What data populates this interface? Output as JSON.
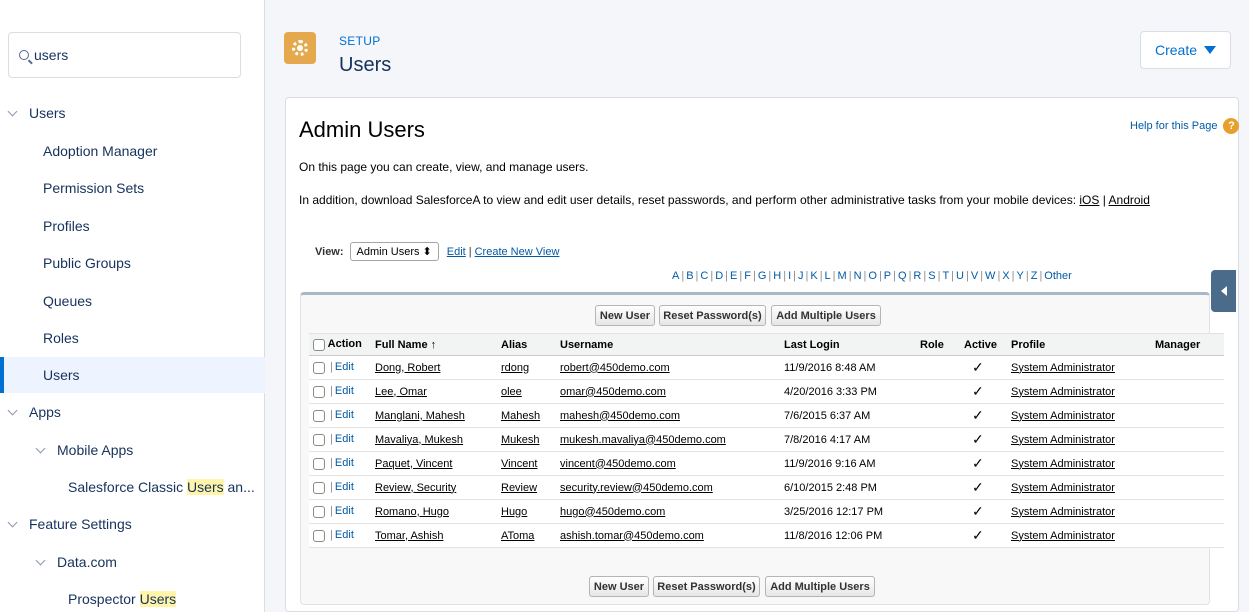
{
  "sidebar": {
    "search_value": "users",
    "items": [
      {
        "label": "Users",
        "level": 0,
        "expanded": true
      },
      {
        "label": "Adoption Manager",
        "level": 1
      },
      {
        "label": "Permission Sets",
        "level": 1
      },
      {
        "label": "Profiles",
        "level": 1
      },
      {
        "label": "Public Groups",
        "level": 1
      },
      {
        "label": "Queues",
        "level": 1
      },
      {
        "label": "Roles",
        "level": 1
      },
      {
        "label": "Users",
        "level": 1,
        "active": true
      },
      {
        "label": "Apps",
        "level": 0,
        "expanded": true
      },
      {
        "label": "Mobile Apps",
        "level": 1,
        "expanded": true
      },
      {
        "label": "Salesforce Classic Users an...",
        "level": 2,
        "highlight": "Users"
      },
      {
        "label": "Feature Settings",
        "level": 0,
        "expanded": true
      },
      {
        "label": "Data.com",
        "level": 1,
        "expanded": true
      },
      {
        "label": "Prospector Users",
        "level": 2,
        "highlight": "Users"
      }
    ]
  },
  "header": {
    "setup_label": "SETUP",
    "title": "Users",
    "create_label": "Create"
  },
  "content": {
    "title": "Admin Users",
    "help_link": "Help for this Page",
    "desc1": "On this page you can create, view, and manage users.",
    "desc2_prefix": "In addition, download SalesforceA to view and edit user details, reset passwords, and perform other administrative tasks from your mobile devices: ",
    "desc2_ios": "iOS",
    "desc2_sep": " | ",
    "desc2_android": "Android",
    "view_label": "View:",
    "view_selected": "Admin Users",
    "view_edit": "Edit",
    "view_create": "Create New View",
    "alphabet": [
      "A",
      "B",
      "C",
      "D",
      "E",
      "F",
      "G",
      "H",
      "I",
      "J",
      "K",
      "L",
      "M",
      "N",
      "O",
      "P",
      "Q",
      "R",
      "S",
      "T",
      "U",
      "V",
      "W",
      "X",
      "Y",
      "Z",
      "Other"
    ]
  },
  "buttons": {
    "new_user": "New User",
    "reset_password": "Reset Password(s)",
    "add_multiple": "Add Multiple Users"
  },
  "table": {
    "columns": [
      "Action",
      "Full Name ↑",
      "Alias",
      "Username",
      "Last Login",
      "Role",
      "Active",
      "Profile",
      "Manager"
    ],
    "edit_label": "Edit",
    "rows": [
      {
        "full_name": "Dong, Robert",
        "alias": "rdong",
        "username": "robert@450demo.com",
        "last_login": "11/9/2016 8:48 AM",
        "role": "",
        "active": "✓",
        "profile": "System Administrator",
        "manager": ""
      },
      {
        "full_name": "Lee, Omar",
        "alias": "olee",
        "username": "omar@450demo.com",
        "last_login": "4/20/2016 3:33 PM",
        "role": "",
        "active": "✓",
        "profile": "System Administrator",
        "manager": ""
      },
      {
        "full_name": "Manglani, Mahesh",
        "alias": "Mahesh",
        "username": "mahesh@450demo.com",
        "last_login": "7/6/2015 6:37 AM",
        "role": "",
        "active": "✓",
        "profile": "System Administrator",
        "manager": ""
      },
      {
        "full_name": "Mavaliya, Mukesh",
        "alias": "Mukesh",
        "username": "mukesh.mavaliya@450demo.com",
        "last_login": "7/8/2016 4:17 AM",
        "role": "",
        "active": "✓",
        "profile": "System Administrator",
        "manager": ""
      },
      {
        "full_name": "Paquet, Vincent",
        "alias": "Vincent",
        "username": "vincent@450demo.com",
        "last_login": "11/9/2016 9:16 AM",
        "role": "",
        "active": "✓",
        "profile": "System Administrator",
        "manager": ""
      },
      {
        "full_name": "Review, Security",
        "alias": "Review",
        "username": "security.review@450demo.com",
        "last_login": "6/10/2015 2:48 PM",
        "role": "",
        "active": "✓",
        "profile": "System Administrator",
        "manager": ""
      },
      {
        "full_name": "Romano, Hugo",
        "alias": "Hugo",
        "username": "hugo@450demo.com",
        "last_login": "3/25/2016 12:17 PM",
        "role": "",
        "active": "✓",
        "profile": "System Administrator",
        "manager": ""
      },
      {
        "full_name": "Tomar, Ashish",
        "alias": "AToma",
        "username": "ashish.tomar@450demo.com",
        "last_login": "11/8/2016 12:06 PM",
        "role": "",
        "active": "✓",
        "profile": "System Administrator",
        "manager": ""
      }
    ]
  },
  "colors": {
    "accent": "#0070d2",
    "setup_icon": "#e6a84c",
    "active_nav_bg": "#eef4ff",
    "highlight": "#fff4a8"
  }
}
